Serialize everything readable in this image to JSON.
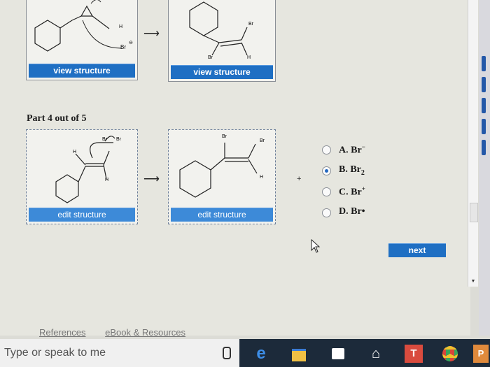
{
  "top_row": {
    "left_card": {
      "button": "view structure",
      "labels": [
        "Br",
        "H"
      ],
      "anion_label": "Br",
      "charge": "⊖"
    },
    "right_card": {
      "button": "view structure",
      "labels": [
        "Br",
        "Br",
        "H"
      ]
    },
    "arrow": "⟶"
  },
  "part_title": "Part 4 out of 5",
  "bottom_row": {
    "left_card": {
      "button": "edit structure",
      "labels": [
        "Br",
        "Br",
        "H",
        "H"
      ]
    },
    "right_card": {
      "button": "edit structure",
      "labels": [
        "Br",
        "Br",
        "H"
      ]
    },
    "arrow": "⟶",
    "plus": "+"
  },
  "choices": [
    {
      "letter": "A.",
      "text": "Br",
      "sup": "−",
      "sub": "",
      "selected": false
    },
    {
      "letter": "B.",
      "text": "Br",
      "sup": "",
      "sub": "2",
      "selected": true
    },
    {
      "letter": "C.",
      "text": "Br",
      "sup": "+",
      "sub": "",
      "selected": false
    },
    {
      "letter": "D.",
      "text": "Br•",
      "sup": "",
      "sub": "",
      "selected": false
    }
  ],
  "next_button": "next",
  "bottom_links": [
    "References",
    "eBook & Resources"
  ],
  "taskbar": {
    "search_placeholder": "Type or speak to me",
    "icons": [
      "microphone-icon",
      "edge-icon",
      "file-explorer-icon",
      "store-icon",
      "home-icon",
      "t-app-icon",
      "chrome-icon",
      "p-app-icon"
    ]
  },
  "colors": {
    "button_blue": "#1f6fc3",
    "taskbar": "#1c2a3a",
    "radio_selected": "#2468c0"
  }
}
